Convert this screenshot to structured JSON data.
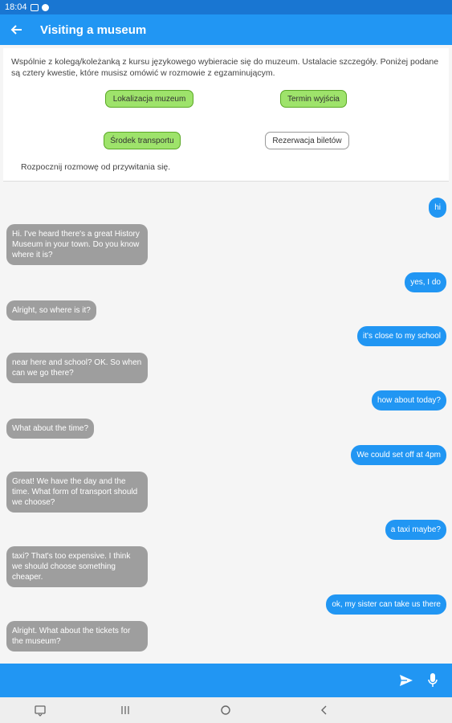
{
  "status_bar": {
    "time": "18:04"
  },
  "app_bar": {
    "title": "Visiting a museum"
  },
  "task": {
    "instruction": "Wspólnie z kolegą/koleżanką z kursu językowego wybieracie się do muzeum. Ustalacie szczegóły. Poniżej podane są cztery kwestie, które musisz omówić w rozmowie z egzaminującym.",
    "topics": [
      {
        "label": "Lokalizacja muzeum",
        "status": "done"
      },
      {
        "label": "Termin wyjścia",
        "status": "done"
      },
      {
        "label": "Środek transportu",
        "status": "done"
      },
      {
        "label": "Rezerwacja biletów",
        "status": "todo"
      }
    ],
    "start_hint": "Rozpocznij rozmowę od przywitania się."
  },
  "messages": [
    {
      "from": "user",
      "text": "hi"
    },
    {
      "from": "bot",
      "text": "Hi. I've heard there's a great History Museum in your town. Do you know where it is?"
    },
    {
      "from": "user",
      "text": "yes, I do"
    },
    {
      "from": "bot",
      "text": "Alright, so where is it?"
    },
    {
      "from": "user",
      "text": "it's close to my school"
    },
    {
      "from": "bot",
      "text": "near here and school? OK. So when can we go there?"
    },
    {
      "from": "user",
      "text": "how about today?"
    },
    {
      "from": "bot",
      "text": "What about the time?"
    },
    {
      "from": "user",
      "text": "We could set off at 4pm"
    },
    {
      "from": "bot",
      "text": "Great! We have the day and the time.  What form of transport should we choose?"
    },
    {
      "from": "user",
      "text": "a taxi maybe?"
    },
    {
      "from": "bot",
      "text": "taxi? That's too expensive. I think we should choose something cheaper."
    },
    {
      "from": "user",
      "text": "ok, my sister can take us there"
    },
    {
      "from": "bot",
      "text": "Alright. What about the tickets for the museum?"
    }
  ],
  "colors": {
    "primary": "#2196f3",
    "status_bar": "#1976d2",
    "bot_bubble": "#9e9e9e",
    "topic_done": "#9ee36b"
  },
  "icons": {
    "back": "arrow-left-icon",
    "send": "send-icon",
    "mic": "microphone-icon"
  }
}
